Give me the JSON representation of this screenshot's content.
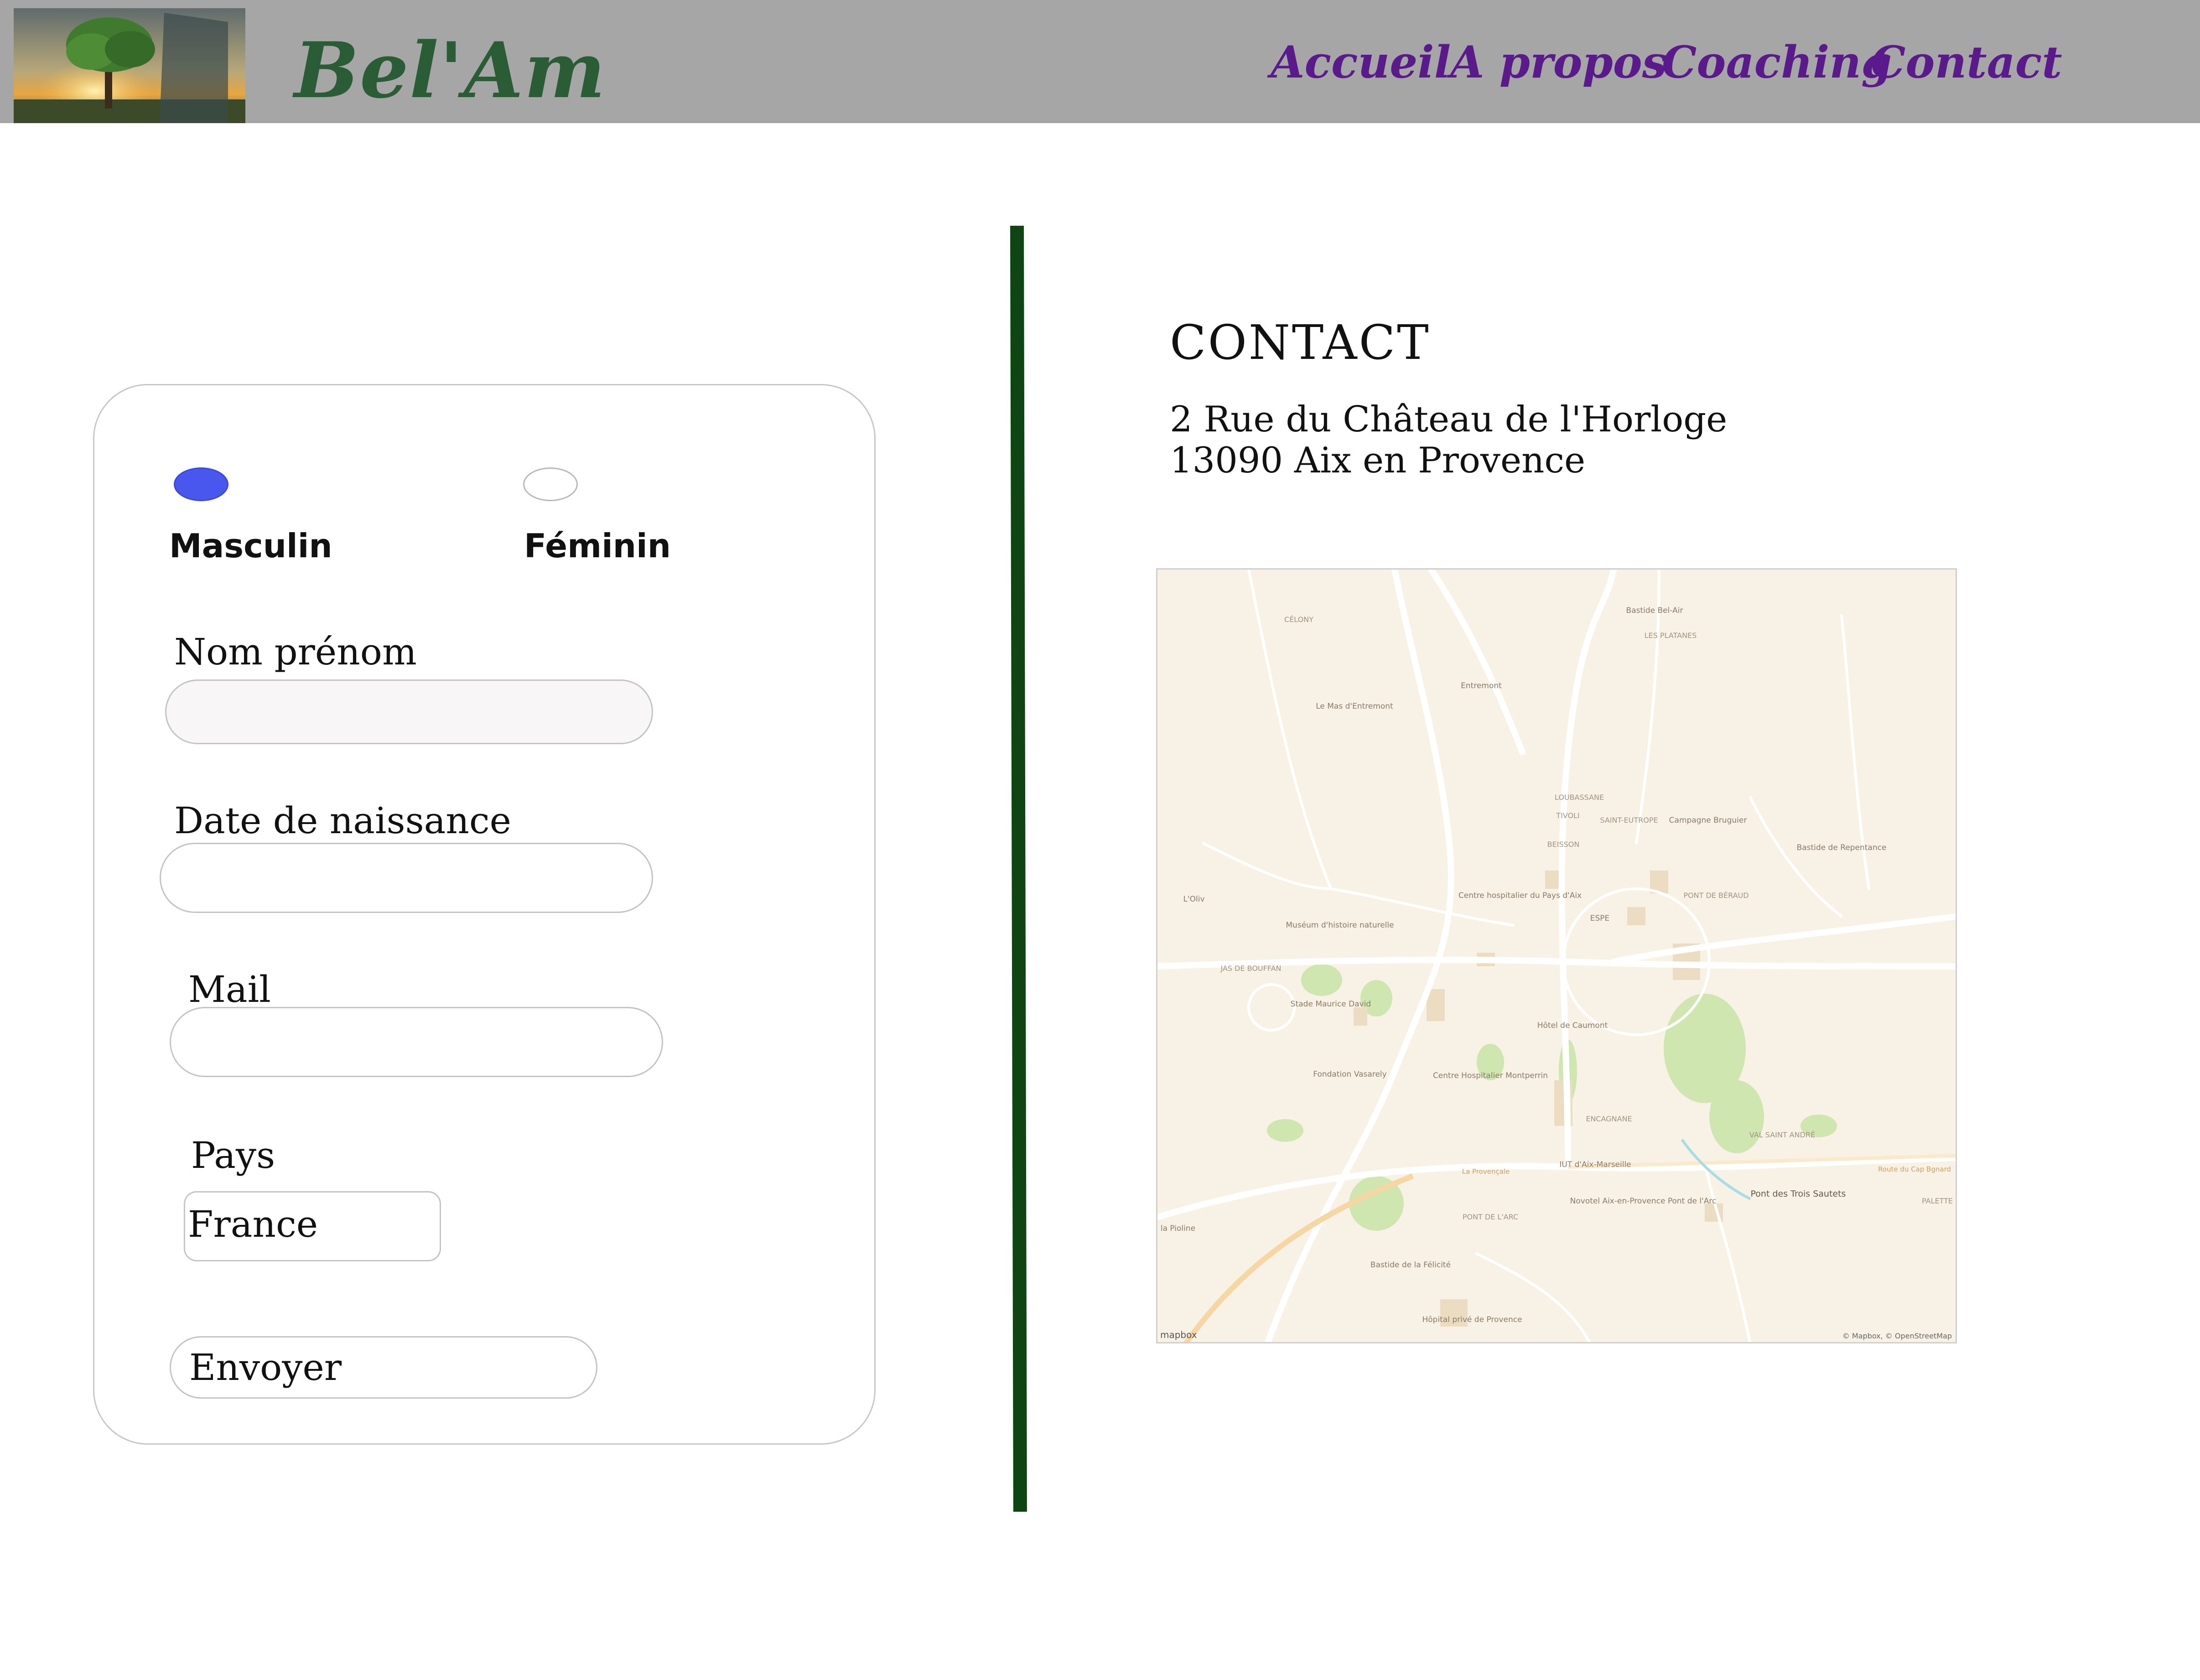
{
  "header": {
    "brand": "Bel'Am",
    "nav": [
      "Accueil",
      "A propos",
      "Coaching",
      "Contact"
    ]
  },
  "form": {
    "gender": {
      "options": [
        "Masculin",
        "Féminin"
      ],
      "selected": "Masculin"
    },
    "fields": {
      "name_label": "Nom prénom",
      "name_value": "",
      "birth_label": "Date de naissance",
      "birth_value": "",
      "mail_label": "Mail",
      "mail_value": "",
      "country_label": "Pays",
      "country_value": "France"
    },
    "submit_label": "Envoyer"
  },
  "contact": {
    "title": "CONTACT",
    "address_line1": "2 Rue du Château de l'Horloge",
    "address_line2": "13090 Aix en Provence"
  },
  "map": {
    "attribution": "© Mapbox, © OpenStreetMap",
    "logo": "mapbox",
    "labels": [
      "Bastide Bel-Air",
      "LES PLATANES",
      "CÉLONY",
      "Entremont",
      "Le Mas d'Entremont",
      "LOUBASSANE",
      "TIVOLI",
      "SAINT-EUTROPE",
      "Campagne Bruguier",
      "Bastide de Repentance",
      "BEISSON",
      "Centre hospitalier du Pays d'Aix",
      "ESPE",
      "PONT DE BÉRAUD",
      "L'Oliv",
      "Muséum d'histoire naturelle",
      "JAS DE BOUFFAN",
      "Stade Maurice David",
      "Hôtel de Caumont",
      "Fondation Vasarely",
      "Centre Hospitalier Montperrin",
      "ENCAGNANE",
      "VAL SAINT ANDRÉ",
      "IUT d'Aix-Marseille",
      "Pont des Trois Sautets",
      "Novotel Aix-en-Provence Pont de l'Arc",
      "PONT DE L'ARC",
      "la Pioline",
      "PALETTE",
      "Bastide de la Félicité",
      "Hôpital privé de Provence",
      "Route du Cap Bgnard",
      "La Provençale"
    ]
  },
  "colors": {
    "header_bg": "#a6a6a6",
    "brand": "#2a5c35",
    "nav": "#5b1a8c",
    "divider": "#0f4512",
    "radio_checked": "#4a57ee"
  }
}
